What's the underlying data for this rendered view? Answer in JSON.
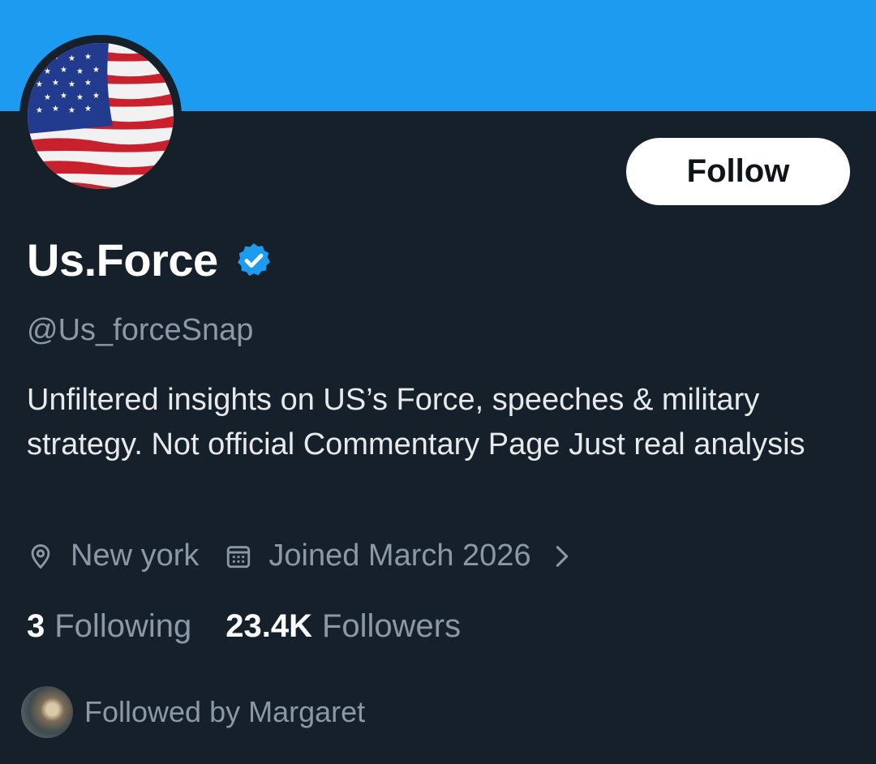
{
  "profile": {
    "display_name": "Us.Force",
    "handle": "@Us_forceSnap",
    "verified": true,
    "bio": "Unfiltered insights on US’s Force, speeches & military strategy. Not official Commentary Page Just real analysis",
    "location": "New york",
    "joined": "Joined March 2026",
    "following_count": "3",
    "following_label": "Following",
    "followers_count": "23.4K",
    "followers_label": "Followers",
    "followed_by": "Followed by Margaret"
  },
  "actions": {
    "follow_label": "Follow"
  },
  "icons": {
    "verified": "verified-badge-icon",
    "location": "location-pin-icon",
    "calendar": "calendar-icon",
    "chevron": "chevron-right-icon"
  },
  "colors": {
    "banner": "#1d9bf0",
    "background": "#16202a",
    "accent": "#1d9bf0",
    "muted_text": "#8b98a5"
  }
}
